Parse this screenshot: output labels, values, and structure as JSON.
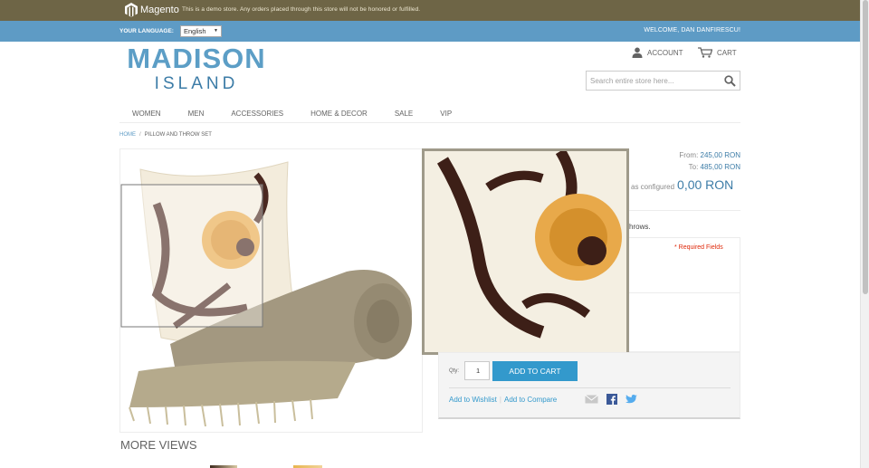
{
  "demo_notice": {
    "brand": "Magento",
    "message": "This is a demo store. Any orders placed through this store will not be honored or fulfilled."
  },
  "header_bar": {
    "language_label": "YOUR LANGUAGE:",
    "language_value": "English",
    "welcome": "WELCOME, DAN DANFIRESCU!"
  },
  "brand": {
    "line1": "MADISON",
    "line2": "ISLAND"
  },
  "account": {
    "account_label": "ACCOUNT",
    "cart_label": "CART",
    "account_icon": "person-icon",
    "cart_icon": "cart-icon"
  },
  "search": {
    "placeholder": "Search entire store here...",
    "icon": "search-icon"
  },
  "nav": {
    "items": [
      "WOMEN",
      "MEN",
      "ACCESSORIES",
      "HOME & DECOR",
      "SALE",
      "VIP"
    ]
  },
  "breadcrumb": {
    "home": "HOME",
    "separator": "/",
    "current": "PILLOW AND THROW SET"
  },
  "product": {
    "from_label": "From:",
    "from_value": "245,00 RON",
    "to_label": "To:",
    "to_value": "485,00 RON",
    "configured_label": "as configured",
    "configured_value": "0,00 RON",
    "description_tail": "hrows.",
    "required_fields": "* Required Fields"
  },
  "cart_panel": {
    "qty_label": "Qty:",
    "qty_value": "1",
    "add_to_cart": "ADD TO CART",
    "add_to_wishlist": "Add to Wishlist",
    "separator": "|",
    "add_to_compare": "Add to Compare"
  },
  "more_views": {
    "title": "MORE VIEWS"
  },
  "colors": {
    "demo_bar": "#6e6546",
    "header_bar": "#5e9bc5",
    "brand": "#5c9ec6",
    "button": "#3399cc",
    "price": "#3c7ca7",
    "required": "#df280a"
  }
}
